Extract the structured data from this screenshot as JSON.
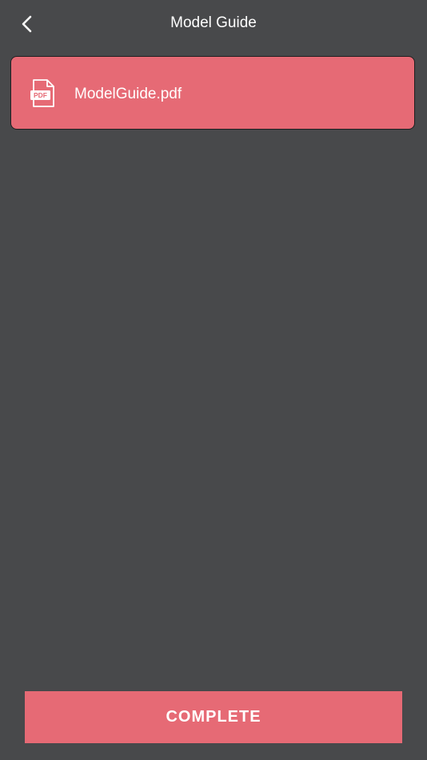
{
  "header": {
    "title": "Model Guide",
    "back_icon": "chevron-left-icon"
  },
  "files": [
    {
      "name": "ModelGuide.pdf",
      "icon": "pdf-file-icon",
      "icon_text": "PDF"
    }
  ],
  "footer": {
    "complete_label": "COMPLETE"
  },
  "colors": {
    "background": "#48494b",
    "accent": "#e66a75",
    "text": "#ffffff",
    "card_border": "#1f1f20"
  }
}
